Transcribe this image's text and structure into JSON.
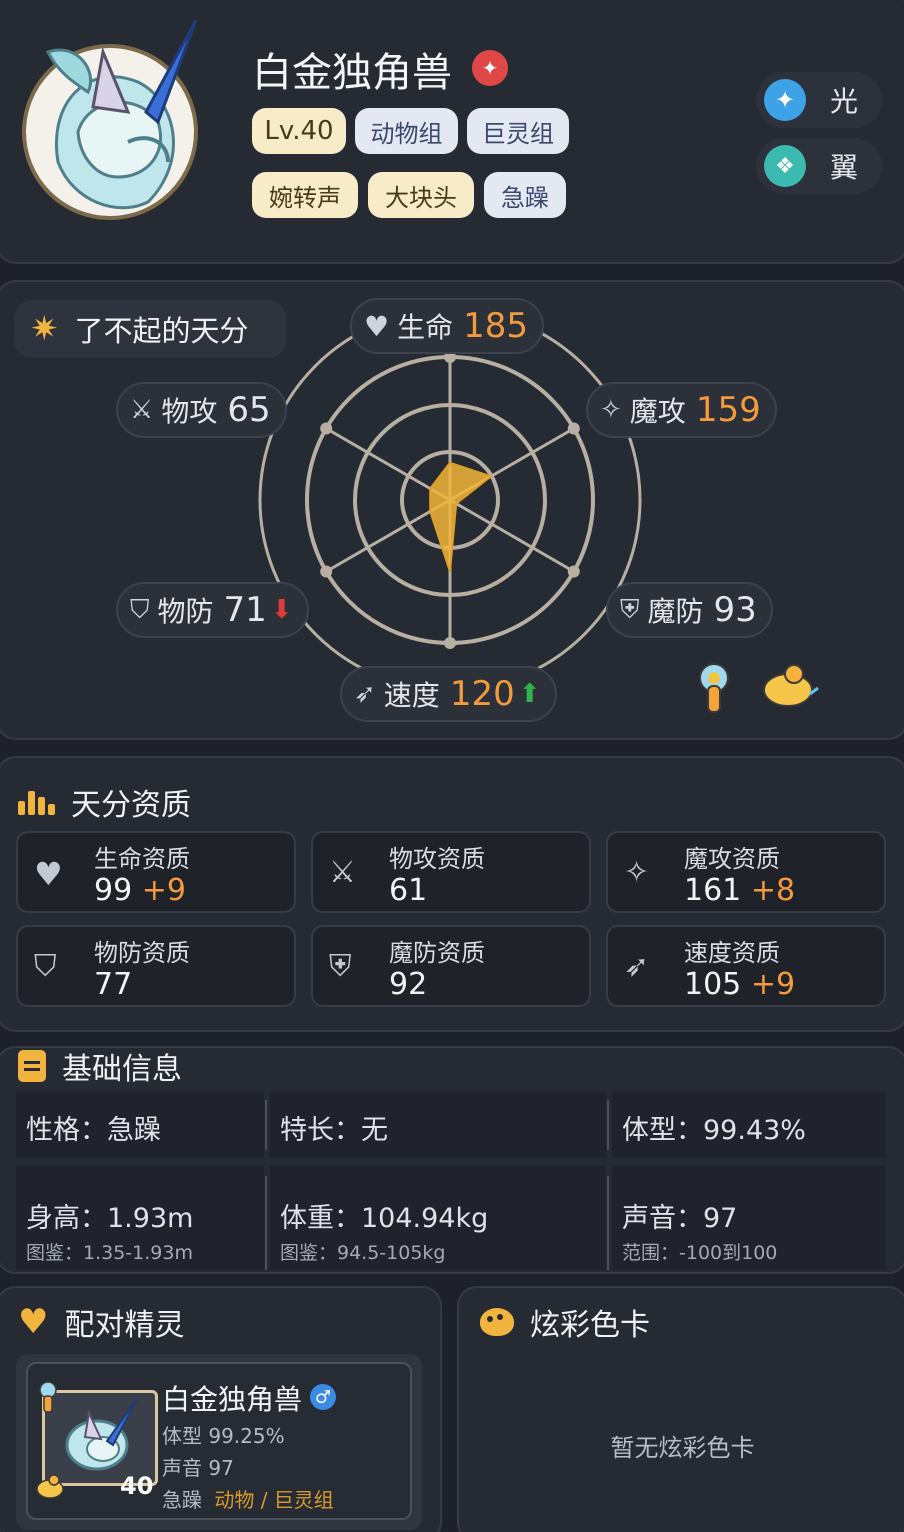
{
  "header": {
    "name": "白金独角兽",
    "tags_row1": [
      "Lv.40",
      "动物组",
      "巨灵组"
    ],
    "tags_row2": [
      "婉转声",
      "大块头",
      "急躁"
    ],
    "attributes": [
      {
        "icon": "light-element-icon",
        "label": "光"
      },
      {
        "icon": "wing-element-icon",
        "label": "翼"
      }
    ]
  },
  "talent": {
    "badge": "了不起的天分",
    "stats": {
      "hp": {
        "label": "生命",
        "value": "185"
      },
      "atk": {
        "label": "物攻",
        "value": "65"
      },
      "matk": {
        "label": "魔攻",
        "value": "159"
      },
      "def": {
        "label": "物防",
        "value": "71"
      },
      "mdef": {
        "label": "魔防",
        "value": "93"
      },
      "spd": {
        "label": "速度",
        "value": "120"
      }
    },
    "radar_levels": {
      "hp": 0.26,
      "matk": 0.33,
      "mdef": 0.05,
      "spd": 0.5,
      "def": 0.16,
      "atk": 0.16
    }
  },
  "aptitude": {
    "title": "天分资质",
    "items": [
      {
        "label": "生命资质",
        "value": "99",
        "bonus": "+9"
      },
      {
        "label": "物攻资质",
        "value": "61",
        "bonus": ""
      },
      {
        "label": "魔攻资质",
        "value": "161",
        "bonus": "+8"
      },
      {
        "label": "物防资质",
        "value": "77",
        "bonus": ""
      },
      {
        "label": "魔防资质",
        "value": "92",
        "bonus": ""
      },
      {
        "label": "速度资质",
        "value": "105",
        "bonus": "+9"
      }
    ]
  },
  "basic": {
    "title": "基础信息",
    "nature": "性格：急躁",
    "specialty": "特长：无",
    "size": "体型：99.43%",
    "height": "身高：1.93m",
    "height_range": "图鉴：1.35-1.93m",
    "weight": "体重：104.94kg",
    "weight_range": "图鉴：94.5-105kg",
    "voice": "声音：97",
    "voice_range": "范围：-100到100"
  },
  "pair": {
    "title": "配对精灵",
    "name": "白金独角兽",
    "gender": "♂",
    "level": "40",
    "size": "体型 99.25%",
    "voice": "声音 97",
    "nature": "急躁",
    "groups": "动物 / 巨灵组"
  },
  "colors_card": {
    "title": "炫彩色卡",
    "empty": "暂无炫彩色卡"
  }
}
